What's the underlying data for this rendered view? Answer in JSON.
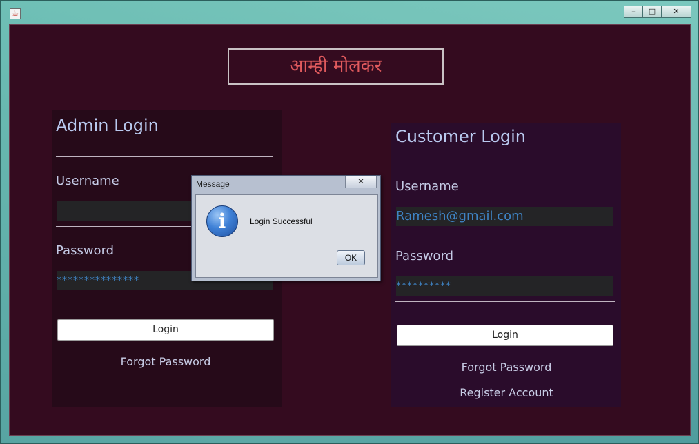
{
  "window": {
    "icon": "java-icon",
    "controls": {
      "minimize": "–",
      "maximize": "□",
      "close": "✕"
    }
  },
  "brand": {
    "title": "आम्ही मोलकर"
  },
  "admin": {
    "heading": "Admin Login",
    "username_label": "Username",
    "username_value": "",
    "password_label": "Password",
    "password_value": "***************",
    "login_label": "Login",
    "forgot_label": "Forgot Password"
  },
  "customer": {
    "heading": "Customer Login",
    "username_label": "Username",
    "username_value": "Ramesh@gmail.com",
    "password_label": "Password",
    "password_value": "**********",
    "login_label": "Login",
    "forgot_label": "Forgot Password",
    "register_label": "Register Account"
  },
  "dialog": {
    "title": "Message",
    "close": "✕",
    "icon": "info-icon",
    "message": "Login Successful",
    "ok_label": "OK"
  },
  "colors": {
    "background": "#340b1f",
    "admin_panel": "#260a19",
    "customer_panel": "#2a0c2b",
    "brand_text": "#e05a5d",
    "heading_text": "#b9c9ef",
    "field_text": "#3f83c3"
  }
}
